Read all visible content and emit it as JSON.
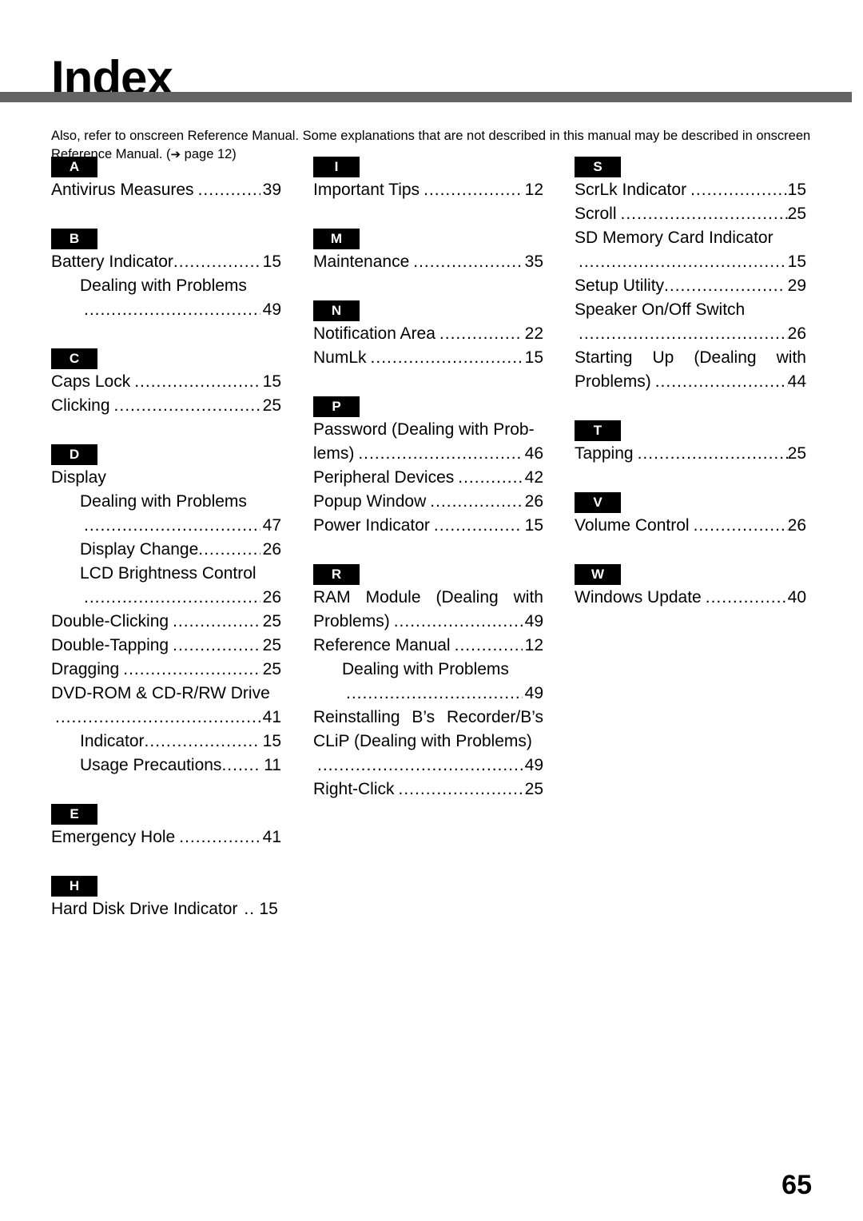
{
  "header": {
    "title": "Index",
    "rule_color": "#646464"
  },
  "intro": {
    "line1": "Also, refer to onscreen Reference Manual. Some explanations that are not described in this manual may be described",
    "line2_pre": "in onscreen Reference Manual. (",
    "arrow": "➔",
    "line2_post": " page 12)"
  },
  "footer": {
    "page_number": "65"
  },
  "columns": [
    {
      "id": "column-1",
      "groups": [
        {
          "letter": "A",
          "entries": [
            {
              "kind": "entry",
              "label": "Antivirus Measures",
              "page": "39",
              "indent": 0
            }
          ]
        },
        {
          "letter": "B",
          "entries": [
            {
              "kind": "entry",
              "label": "Battery Indicator",
              "page": "15",
              "indent": 0,
              "tight": true
            },
            {
              "kind": "title",
              "label": "Dealing with Problems",
              "indent": 1
            },
            {
              "kind": "leader-only",
              "page": "49",
              "indent": 1
            }
          ]
        },
        {
          "letter": "C",
          "entries": [
            {
              "kind": "entry",
              "label": "Caps Lock",
              "page": "15",
              "indent": 0
            },
            {
              "kind": "entry",
              "label": "Clicking",
              "page": "25",
              "indent": 0
            }
          ]
        },
        {
          "letter": "D",
          "entries": [
            {
              "kind": "title",
              "label": "Display",
              "indent": 0
            },
            {
              "kind": "title",
              "label": "Dealing with Problems",
              "indent": 1
            },
            {
              "kind": "leader-only",
              "page": "47",
              "indent": 1
            },
            {
              "kind": "entry",
              "label": "Display Change",
              "page": "26",
              "indent": 1,
              "tight": true
            },
            {
              "kind": "title",
              "label": "LCD Brightness Control",
              "indent": 1
            },
            {
              "kind": "leader-only",
              "page": "26",
              "indent": 1
            },
            {
              "kind": "entry",
              "label": "Double-Clicking",
              "page": "25",
              "indent": 0
            },
            {
              "kind": "entry",
              "label": "Double-Tapping",
              "page": "25",
              "indent": 0
            },
            {
              "kind": "entry",
              "label": "Dragging",
              "page": "25",
              "indent": 0
            },
            {
              "kind": "title",
              "label": "DVD-ROM & CD-R/RW Drive",
              "indent": 0
            },
            {
              "kind": "leader-only",
              "page": "41",
              "indent": 0
            },
            {
              "kind": "entry",
              "label": "Indicator",
              "page": "15",
              "indent": 1,
              "tight": true
            },
            {
              "kind": "entry",
              "label": "Usage Precautions",
              "page": "11",
              "indent": 1,
              "tight": true
            }
          ]
        },
        {
          "letter": "E",
          "entries": [
            {
              "kind": "entry",
              "label": "Emergency Hole",
              "page": "41",
              "indent": 0
            }
          ]
        },
        {
          "letter": "H",
          "entries": [
            {
              "kind": "entry",
              "label": "Hard Disk Drive Indicator",
              "page": "15",
              "indent": 0,
              "short_leader": true
            }
          ]
        }
      ]
    },
    {
      "id": "column-2",
      "groups": [
        {
          "letter": "I",
          "entries": [
            {
              "kind": "entry",
              "label": "Important Tips",
              "page": "12",
              "indent": 0
            }
          ]
        },
        {
          "letter": "M",
          "entries": [
            {
              "kind": "entry",
              "label": "Maintenance",
              "page": "35",
              "indent": 0
            }
          ]
        },
        {
          "letter": "N",
          "entries": [
            {
              "kind": "entry",
              "label": "Notification Area",
              "page": "22",
              "indent": 0
            },
            {
              "kind": "entry",
              "label": "NumLk",
              "page": "15",
              "indent": 0
            }
          ]
        },
        {
          "letter": "P",
          "entries": [
            {
              "kind": "title",
              "label": "Password (Dealing with Prob-",
              "indent": 0
            },
            {
              "kind": "entry",
              "label": "lems)",
              "page": "46",
              "indent": 0
            },
            {
              "kind": "entry",
              "label": "Peripheral Devices",
              "page": "42",
              "indent": 0
            },
            {
              "kind": "entry",
              "label": "Popup Window",
              "page": "26",
              "indent": 0
            },
            {
              "kind": "entry",
              "label": "Power Indicator",
              "page": "15",
              "indent": 0
            }
          ]
        },
        {
          "letter": "R",
          "entries": [
            {
              "kind": "justified",
              "words": [
                "RAM",
                "Module",
                "(Dealing",
                "with"
              ]
            },
            {
              "kind": "entry",
              "label": "Problems)",
              "page": "49",
              "indent": 0
            },
            {
              "kind": "entry",
              "label": "Reference Manual",
              "page": "12",
              "indent": 0
            },
            {
              "kind": "title",
              "label": "Dealing with Problems",
              "indent": 1
            },
            {
              "kind": "leader-only",
              "page": "49",
              "indent": 1
            },
            {
              "kind": "justified",
              "words": [
                "Reinstalling",
                "B’s",
                "Recorder/B’s"
              ]
            },
            {
              "kind": "title",
              "label": "CLiP (Dealing with Problems)",
              "indent": 0
            },
            {
              "kind": "leader-only",
              "page": "49",
              "indent": 0
            },
            {
              "kind": "entry",
              "label": "Right-Click",
              "page": "25",
              "indent": 0
            }
          ]
        }
      ]
    },
    {
      "id": "column-3",
      "groups": [
        {
          "letter": "S",
          "entries": [
            {
              "kind": "entry",
              "label": "ScrLk Indicator",
              "page": "15",
              "indent": 0,
              "tight_right": true
            },
            {
              "kind": "entry",
              "label": "Scroll",
              "page": "25",
              "indent": 0,
              "tight_right": true
            },
            {
              "kind": "title",
              "label": "SD Memory Card Indicator",
              "indent": 0
            },
            {
              "kind": "leader-only",
              "page": "15",
              "indent": 0
            },
            {
              "kind": "entry",
              "label": "Setup Utility",
              "page": "29",
              "indent": 0,
              "tight": true
            },
            {
              "kind": "title",
              "label": "Speaker On/Off Switch",
              "indent": 0
            },
            {
              "kind": "leader-only",
              "page": "26",
              "indent": 0,
              "tight_right": true
            },
            {
              "kind": "justified",
              "words": [
                "Starting",
                "Up",
                "(Dealing",
                "with"
              ]
            },
            {
              "kind": "entry",
              "label": "Problems)",
              "page": "44",
              "indent": 0,
              "tight_right": true
            }
          ]
        },
        {
          "letter": "T",
          "entries": [
            {
              "kind": "entry",
              "label": "Tapping",
              "page": "25",
              "indent": 0,
              "tight_right": true
            }
          ]
        },
        {
          "letter": "V",
          "entries": [
            {
              "kind": "entry",
              "label": "Volume Control",
              "page": "26",
              "indent": 0,
              "tight_right": true
            }
          ]
        },
        {
          "letter": "W",
          "entries": [
            {
              "kind": "entry",
              "label": "Windows Update",
              "page": "40",
              "indent": 0,
              "tight_right": true
            }
          ]
        }
      ]
    }
  ]
}
